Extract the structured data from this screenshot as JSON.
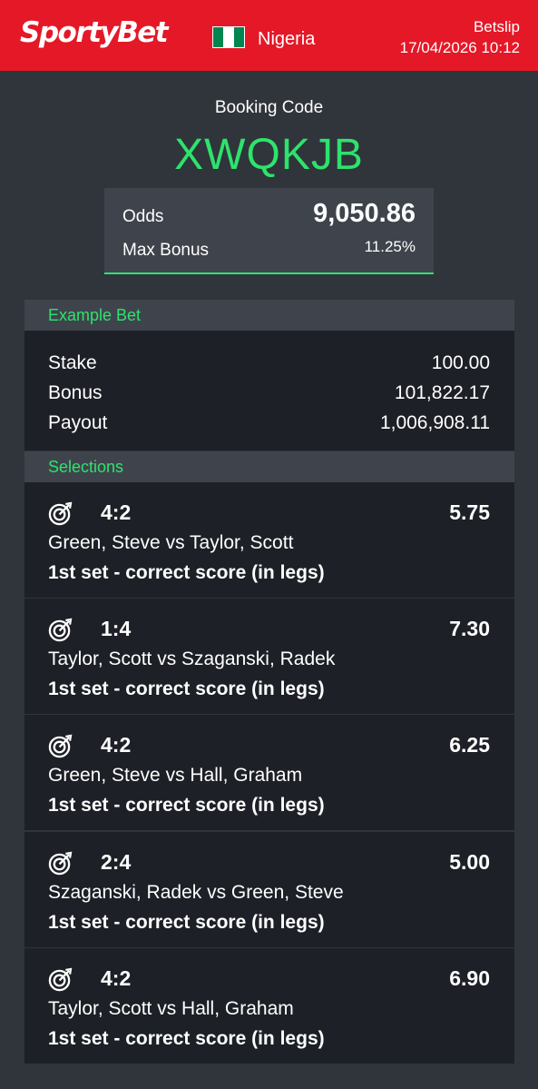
{
  "header": {
    "logo_text": "SportyBet",
    "country": "Nigeria",
    "betslip_label": "Betslip",
    "datetime": "17/04/2026 10:12"
  },
  "booking": {
    "label": "Booking Code",
    "code": "XWQKJB"
  },
  "summary": {
    "odds_label": "Odds",
    "odds_value": "9,050.86",
    "bonus_label": "Max Bonus",
    "bonus_value": "11.25%"
  },
  "example_bet": {
    "heading": "Example Bet",
    "rows": [
      {
        "label": "Stake",
        "value": "100.00"
      },
      {
        "label": "Bonus",
        "value": "101,822.17"
      },
      {
        "label": "Payout",
        "value": "1,006,908.11"
      }
    ]
  },
  "selections": {
    "heading": "Selections",
    "items": [
      {
        "score": "4:2",
        "odds": "5.75",
        "match": "Green, Steve vs Taylor, Scott",
        "market": "1st set - correct score (in legs)"
      },
      {
        "score": "1:4",
        "odds": "7.30",
        "match": "Taylor, Scott vs Szaganski, Radek",
        "market": "1st set - correct score (in legs)"
      },
      {
        "score": "4:2",
        "odds": "6.25",
        "match": "Green, Steve vs Hall, Graham",
        "market": "1st set - correct score (in legs)"
      },
      {
        "score": "2:4",
        "odds": "5.00",
        "match": "Szaganski, Radek vs Green, Steve",
        "market": "1st set - correct score (in legs)"
      },
      {
        "score": "4:2",
        "odds": "6.90",
        "match": "Taylor, Scott vs Hall, Graham",
        "market": "1st set - correct score (in legs)"
      }
    ]
  },
  "colors": {
    "brand_red": "#e41827",
    "accent_green": "#2de36c",
    "background": "#30343b",
    "panel": "#1d2026",
    "panel_header": "#3f444c"
  },
  "icons": {
    "selection_icon": "dartboard-icon",
    "flag": "nigeria-flag-icon"
  }
}
